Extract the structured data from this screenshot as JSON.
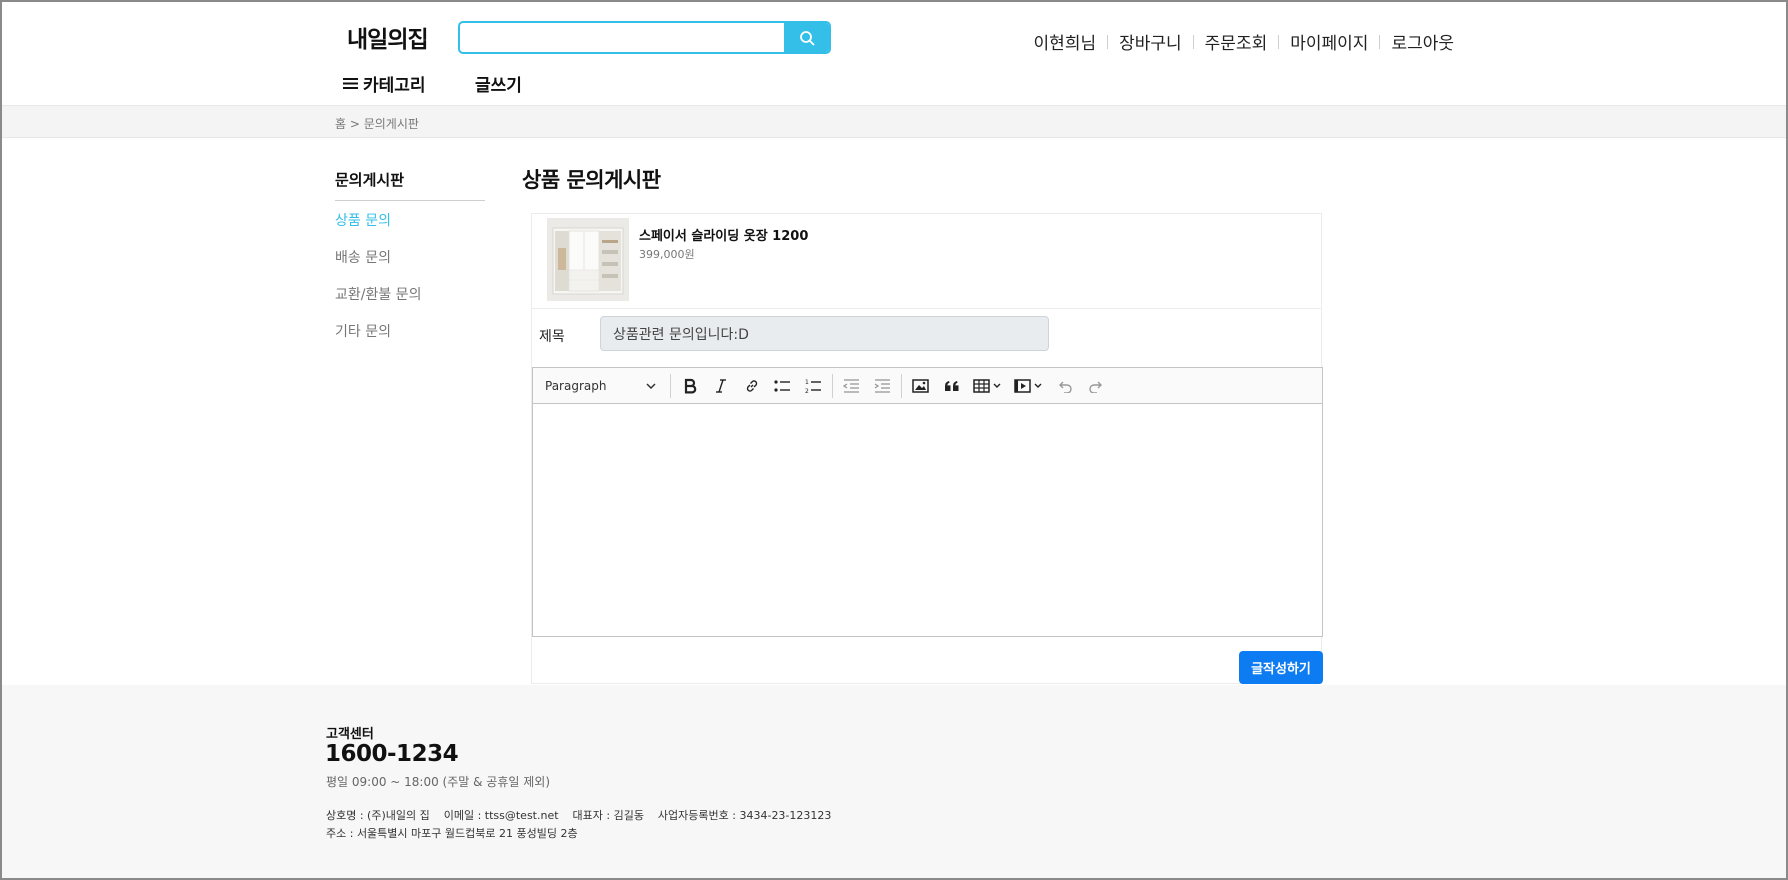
{
  "header": {
    "logo": "내일의집",
    "search": {
      "value": "",
      "placeholder": ""
    },
    "nav": [
      "이현희님",
      "장바구니",
      "주문조회",
      "마이페이지",
      "로그아웃"
    ],
    "category_label": "카테고리",
    "write_label": "글쓰기",
    "accent_color": "#33bfe8"
  },
  "breadcrumb": "홈 > 문의게시판",
  "sidebar": {
    "title": "문의게시판",
    "items": [
      {
        "label": "상품 문의",
        "active": true
      },
      {
        "label": "배송 문의",
        "active": false
      },
      {
        "label": "교환/환불 문의",
        "active": false
      },
      {
        "label": "기타 문의",
        "active": false
      }
    ]
  },
  "main": {
    "title": "상품 문의게시판",
    "product": {
      "name": "스페이서 슬라이딩 옷장 1200",
      "price": "399,000원"
    },
    "subject": {
      "label": "제목",
      "value": "상품관련 문의입니다:D"
    },
    "editor": {
      "block_format": "Paragraph",
      "tools": [
        "bold-icon",
        "italic-icon",
        "link-icon",
        "bulleted-list-icon",
        "numbered-list-icon",
        "outdent-icon",
        "indent-icon",
        "image-icon",
        "quote-icon",
        "table-icon",
        "media-icon",
        "undo-icon",
        "redo-icon"
      ],
      "content": ""
    },
    "submit_label": "글작성하기",
    "submit_color": "#0d7cf2"
  },
  "footer": {
    "cs_title": "고객센터",
    "phone": "1600-1234",
    "hours": "평일 09:00 ~ 18:00 (주말 & 공휴일 제외)",
    "business_line": "상호명 : (주)내일의 집    이메일 : ttss@test.net    대표자 : 김길동    사업자등록번호 : 3434-23-123123",
    "address_line": "주소 : 서울특별시 마포구 월드컵북로 21 풍성빌딩 2층"
  }
}
